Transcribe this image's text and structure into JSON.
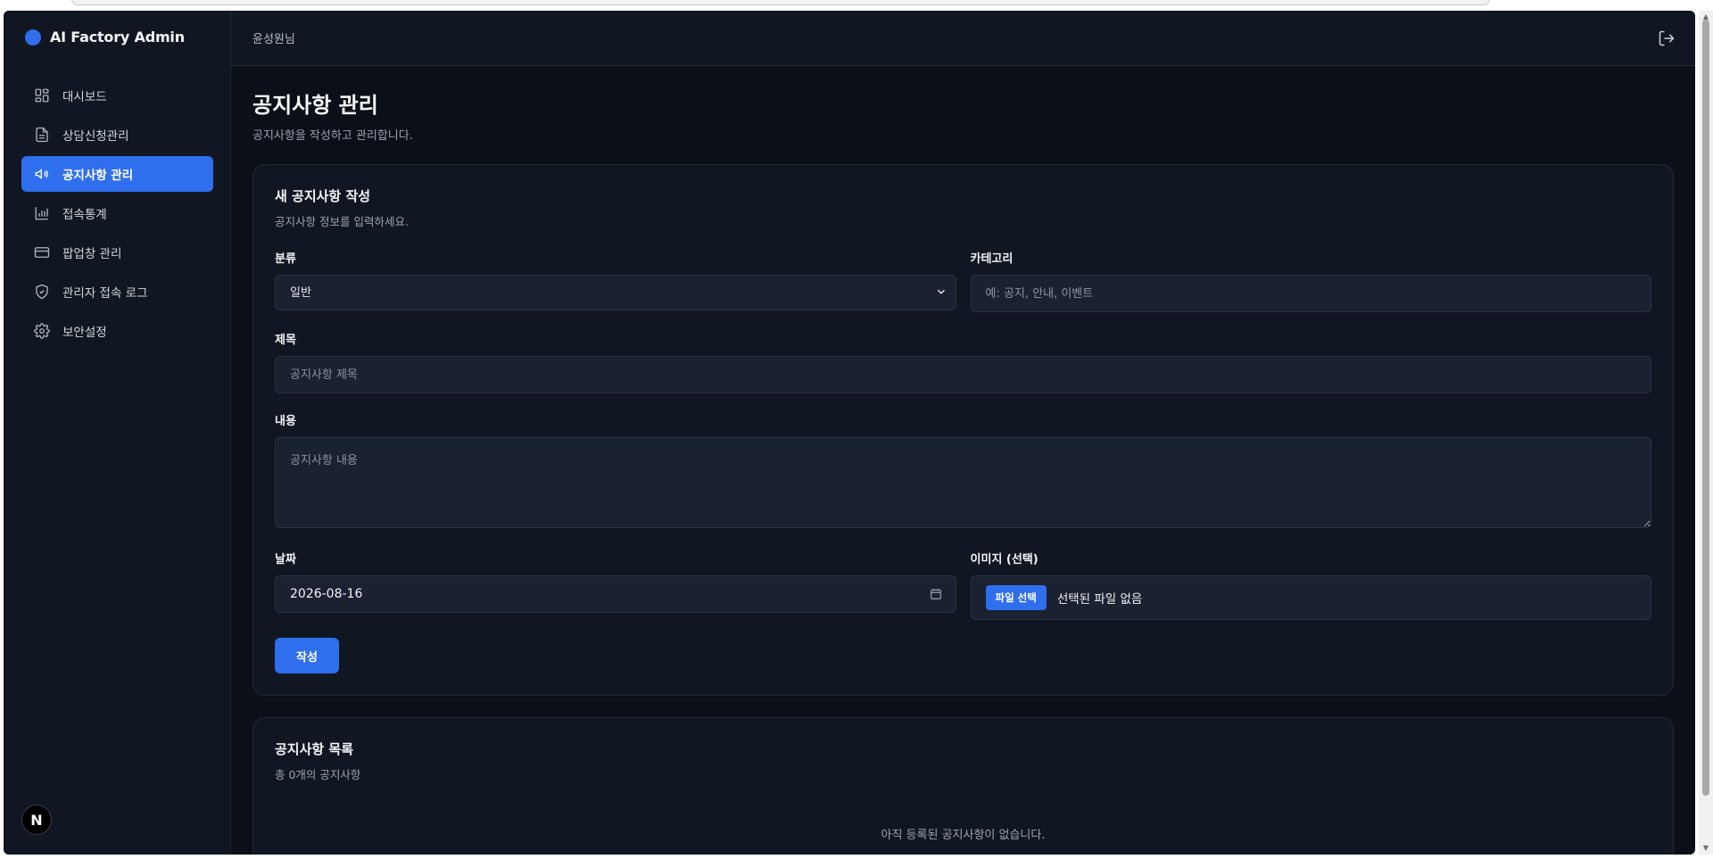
{
  "app": {
    "title": "AI Factory Admin"
  },
  "sidebar": {
    "items": [
      {
        "label": "대시보드",
        "icon": "dashboard-icon",
        "active": false
      },
      {
        "label": "상담신청관리",
        "icon": "document-icon",
        "active": false
      },
      {
        "label": "공지사항 관리",
        "icon": "megaphone-icon",
        "active": true
      },
      {
        "label": "접속통계",
        "icon": "bar-chart-icon",
        "active": false
      },
      {
        "label": "팝업창 관리",
        "icon": "window-icon",
        "active": false
      },
      {
        "label": "관리자 접속 로그",
        "icon": "shield-icon",
        "active": false
      },
      {
        "label": "보안설정",
        "icon": "gear-icon",
        "active": false
      }
    ],
    "badge": "N"
  },
  "header": {
    "user": "윤성원님"
  },
  "page": {
    "title": "공지사항 관리",
    "subtitle": "공지사항을 작성하고 관리합니다."
  },
  "form": {
    "title": "새 공지사항 작성",
    "subtitle": "공지사항 정보를 입력하세요.",
    "type_label": "분류",
    "type_value": "일반",
    "category_label": "카테고리",
    "category_placeholder": "예: 공지, 안내, 이벤트",
    "subject_label": "제목",
    "subject_placeholder": "공지사항 제목",
    "content_label": "내용",
    "content_placeholder": "공지사항 내용",
    "date_label": "날짜",
    "date_value": "2026-08-16",
    "image_label": "이미지 (선택)",
    "file_button": "파일 선택",
    "file_status": "선택된 파일 없음",
    "submit_label": "작성"
  },
  "list": {
    "title": "공지사항 목록",
    "count_text": "총 0개의 공지사항",
    "empty_text": "아직 등록된 공지사항이 없습니다."
  },
  "colors": {
    "accent": "#2f6fed",
    "background": "#0b0f17",
    "panel": "#111722"
  }
}
